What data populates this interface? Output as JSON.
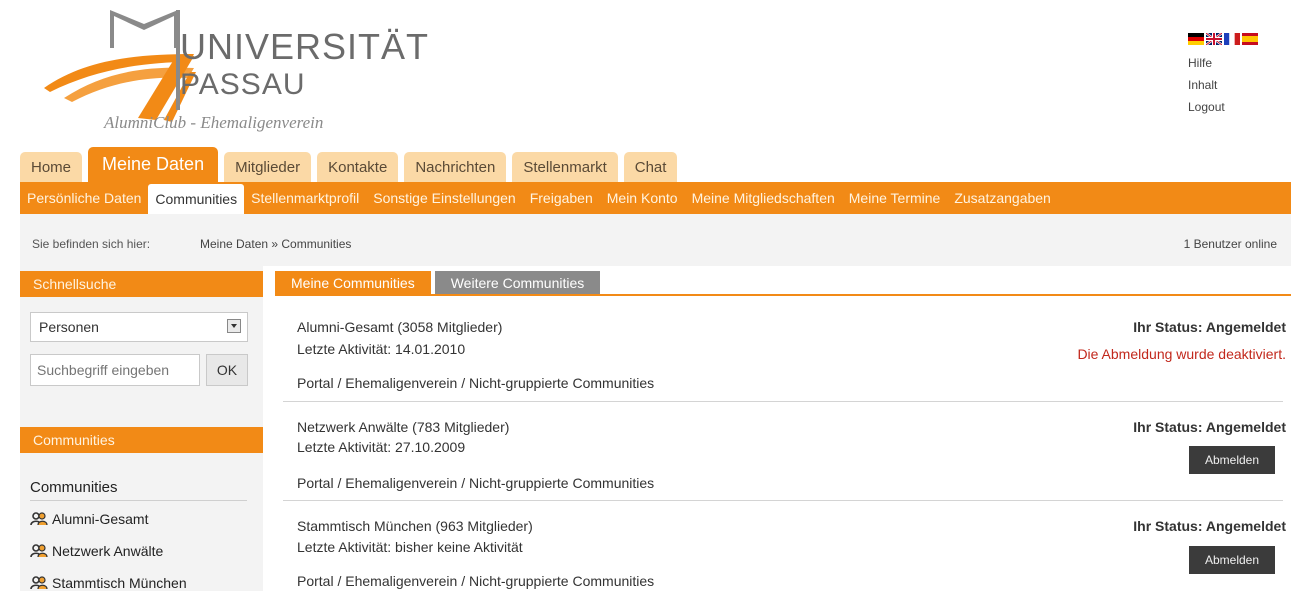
{
  "brand": {
    "line1": "UNIVERSITÄT",
    "line2": "PASSAU",
    "subtitle": "AlumniClub - Ehemaligenverein"
  },
  "flags": [
    "Deutsch",
    "English",
    "Italiano",
    "Español"
  ],
  "top_links": [
    "Hilfe",
    "Inhalt",
    "Logout"
  ],
  "main_tabs": [
    "Home",
    "Meine Daten",
    "Mitglieder",
    "Kontakte",
    "Nachrichten",
    "Stellenmarkt",
    "Chat"
  ],
  "sub_tabs": [
    "Persönliche Daten",
    "Communities",
    "Stellenmarktprofil",
    "Sonstige Einstellungen",
    "Freigaben",
    "Mein Konto",
    "Meine Mitgliedschaften",
    "Meine Termine",
    "Zusatzangaben"
  ],
  "breadcrumb": {
    "label": "Sie befinden sich hier:",
    "path": "Meine Daten » Communities",
    "online": "1 Benutzer online"
  },
  "sidebar": {
    "quicksearch_title": "Schnellsuche",
    "select_value": "Personen",
    "search_placeholder": "Suchbegriff eingeben",
    "ok_label": "OK",
    "communities_header": "Communities",
    "communities_title": "Communities",
    "links": [
      "Alumni-Gesamt",
      "Netzwerk Anwälte",
      "Stammtisch München"
    ]
  },
  "content": {
    "tabs": [
      "Meine Communities",
      "Weitere Communities"
    ],
    "rows": [
      {
        "title": "Alumni-Gesamt (3058 Mitglieder)",
        "activity": "Letzte Aktivität: 14.01.2010",
        "path": "Portal / Ehemaligenverein / Nicht-gruppierte Communities",
        "status": "Ihr Status: Angemeldet",
        "note": "Die Abmeldung wurde deaktiviert."
      },
      {
        "title": "Netzwerk Anwälte (783 Mitglieder)",
        "activity": "Letzte Aktivität: 27.10.2009",
        "path": "Portal / Ehemaligenverein / Nicht-gruppierte Communities",
        "status": "Ihr Status: Angemeldet",
        "button": "Abmelden"
      },
      {
        "title": "Stammtisch München (963 Mitglieder)",
        "activity": "Letzte Aktivität: bisher keine Aktivität",
        "path": "Portal / Ehemaligenverein / Nicht-gruppierte Communities",
        "status": "Ihr Status: Angemeldet",
        "button": "Abmelden"
      }
    ]
  },
  "colors": {
    "accent": "#f28a16",
    "tab_inactive": "#fbd9a6",
    "tab_grey": "#8a8a8a",
    "warning": "#c2281c",
    "button_dark": "#3b3b3b"
  }
}
